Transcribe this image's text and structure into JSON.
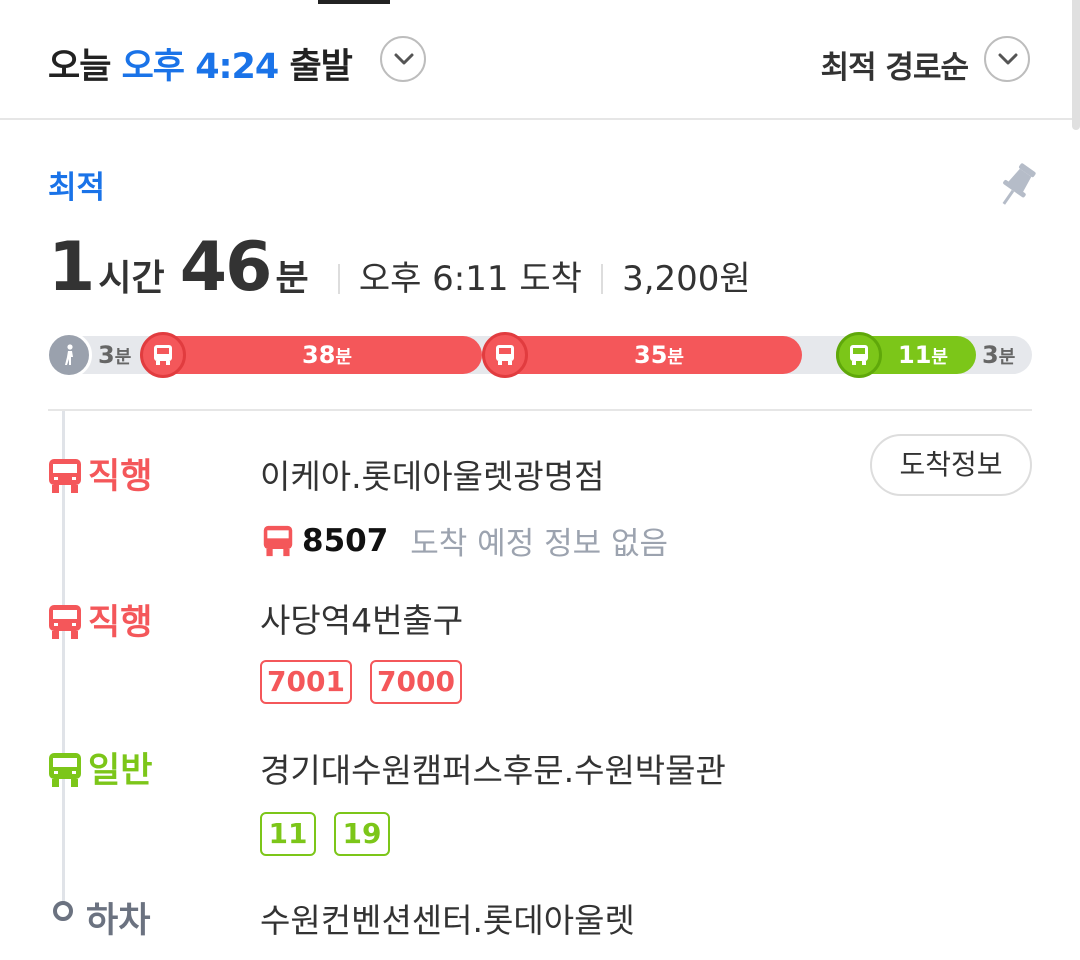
{
  "header": {
    "day": "오늘",
    "time_period": "오후",
    "time": "4:24",
    "depart_label": "출발",
    "sort_label": "최적 경로순"
  },
  "route": {
    "badge": "최적",
    "duration_hours": "1",
    "hours_unit": "시간",
    "duration_minutes": "46",
    "minutes_unit": "분",
    "arrival": "오후 6:11 도착",
    "fare": "3,200원"
  },
  "timeline": {
    "walk_start": {
      "minutes": "3",
      "unit": "분"
    },
    "legs": [
      {
        "minutes": "38",
        "unit": "분",
        "type": "red-bus"
      },
      {
        "minutes": "35",
        "unit": "분",
        "type": "red-bus"
      },
      {
        "minutes": "11",
        "unit": "분",
        "type": "green-bus"
      }
    ],
    "walk_end": {
      "minutes": "3",
      "unit": "분"
    }
  },
  "steps": [
    {
      "type_label": "직행",
      "stop": "이케아.롯데아울렛광명점",
      "action_label": "도착정보",
      "bus_number": "8507",
      "bus_note": "도착 예정 정보 없음"
    },
    {
      "type_label": "직행",
      "stop": "사당역4번출구",
      "buses": [
        "7001",
        "7000"
      ]
    },
    {
      "type_label": "일반",
      "stop": "경기대수원캠퍼스후문.수원박물관",
      "buses": [
        "11",
        "19"
      ]
    },
    {
      "type_label": "하차",
      "stop": "수원컨벤션센터.롯데아울렛"
    }
  ],
  "colors": {
    "accent_blue": "#1a73e8",
    "express_red": "#f4575a",
    "general_green": "#7cc619",
    "walk_gray": "#9aa1ad"
  },
  "icons": [
    "chevron-down-icon",
    "pin-icon",
    "walk-icon",
    "bus-icon"
  ]
}
